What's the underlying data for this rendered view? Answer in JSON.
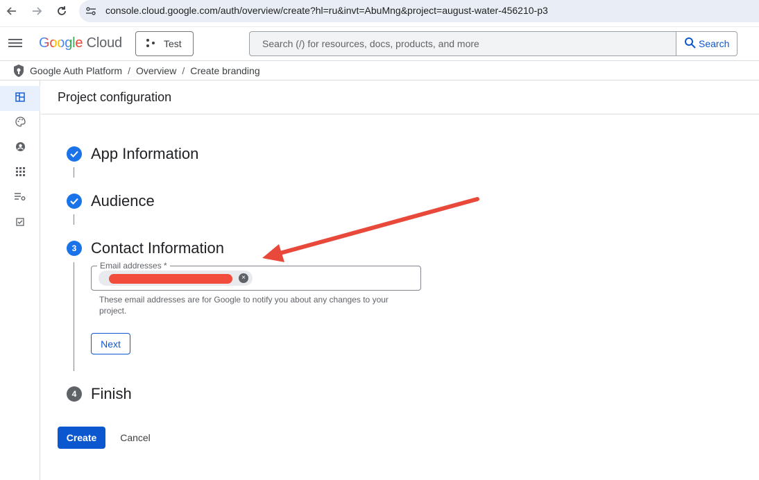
{
  "browser": {
    "url": "console.cloud.google.com/auth/overview/create?hl=ru&invt=AbuMng&project=august-water-456210-p3",
    "back_icon": "arrow-left-icon",
    "forward_icon": "arrow-right-icon",
    "reload_icon": "reload-icon",
    "site_info_icon": "tune-icon"
  },
  "header": {
    "logo_google": "Google",
    "logo_cloud": "Cloud",
    "project_name": "Test",
    "search_placeholder": "Search (/) for resources, docs, products, and more",
    "search_button": "Search"
  },
  "breadcrumb": {
    "items": [
      "Google Auth Platform",
      "Overview",
      "Create branding"
    ],
    "separator": "/"
  },
  "left_rail": {
    "items": [
      {
        "icon": "dashboard-icon",
        "active": true
      },
      {
        "icon": "palette-icon",
        "active": false
      },
      {
        "icon": "account-circle-icon",
        "active": false
      },
      {
        "icon": "apps-grid-icon",
        "active": false
      },
      {
        "icon": "list-settings-icon",
        "active": false
      },
      {
        "icon": "checkbox-icon",
        "active": false
      }
    ]
  },
  "page": {
    "title": "Project configuration"
  },
  "steps": [
    {
      "number": "1",
      "title": "App Information",
      "state": "done"
    },
    {
      "number": "2",
      "title": "Audience",
      "state": "done"
    },
    {
      "number": "3",
      "title": "Contact Information",
      "state": "active"
    },
    {
      "number": "4",
      "title": "Finish",
      "state": "pending"
    }
  ],
  "contact_form": {
    "email_label": "Email addresses *",
    "chip_remove": "×",
    "helper_text": "These email addresses are for Google to notify you about any changes to your project.",
    "next_button": "Next"
  },
  "actions": {
    "create_button": "Create",
    "cancel_button": "Cancel"
  },
  "colors": {
    "accent": "#0b57d0",
    "step_done": "#1a73e8",
    "step_pending": "#5f6368",
    "annotation_arrow": "#e8493a",
    "redaction": "#f24c3d"
  }
}
